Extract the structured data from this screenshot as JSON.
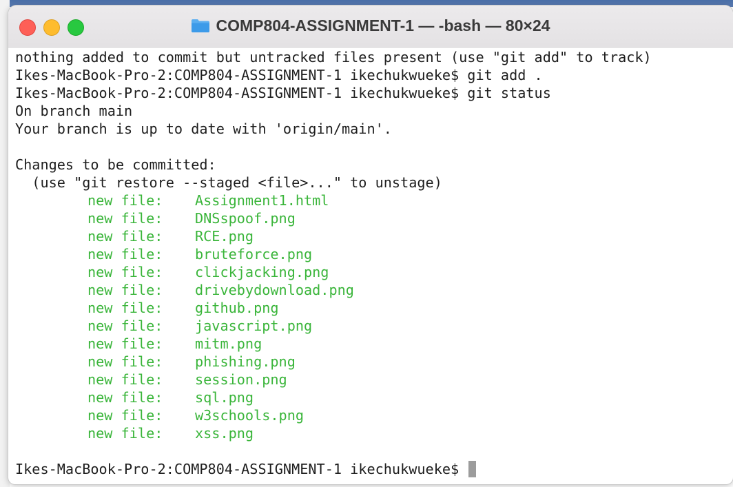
{
  "window": {
    "title": "COMP804-ASSIGNMENT-1 — -bash — 80×24",
    "folder_icon": "folder-icon",
    "traffic_lights": {
      "close_color": "#fe5f57",
      "minimize_color": "#febc2e",
      "zoom_color": "#28c840"
    }
  },
  "terminal": {
    "lines": [
      "nothing added to commit but untracked files present (use \"git add\" to track)",
      "Ikes-MacBook-Pro-2:COMP804-ASSIGNMENT-1 ikechukwueke$ git add .",
      "Ikes-MacBook-Pro-2:COMP804-ASSIGNMENT-1 ikechukwueke$ git status",
      "On branch main",
      "Your branch is up to date with 'origin/main'.",
      "",
      "Changes to be committed:",
      "  (use \"git restore --staged <file>...\" to unstage)"
    ],
    "new_file_label": "new file:",
    "new_files": [
      "Assignment1.html",
      "DNSspoof.png",
      "RCE.png",
      "bruteforce.png",
      "clickjacking.png",
      "drivebydownload.png",
      "github.png",
      "javascript.png",
      "mitm.png",
      "phishing.png",
      "session.png",
      "sql.png",
      "w3schools.png",
      "xss.png"
    ],
    "prompt": "Ikes-MacBook-Pro-2:COMP804-ASSIGNMENT-1 ikechukwueke$ ",
    "colors": {
      "text": "#1e1e1e",
      "staged_file": "#3ab53a",
      "cursor": "#9c9c9c"
    }
  }
}
